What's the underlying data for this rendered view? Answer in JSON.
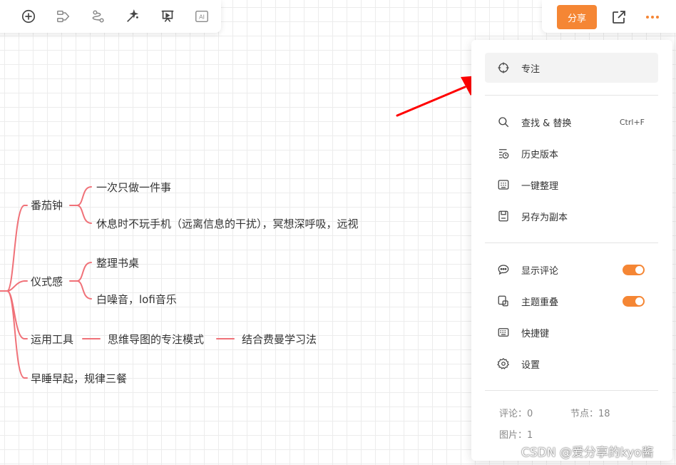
{
  "toolbar": {
    "tools": [
      {
        "icon": "add-circle-icon"
      },
      {
        "icon": "branch-icon"
      },
      {
        "icon": "relation-icon"
      },
      {
        "icon": "magic-icon"
      },
      {
        "icon": "presentation-icon"
      },
      {
        "icon": "ai-icon",
        "label": "AI"
      }
    ]
  },
  "header": {
    "share_label": "分享",
    "export_icon": "export-icon",
    "more_icon": "more-icon"
  },
  "menu": {
    "focus": {
      "label": "专注",
      "icon": "focus-icon"
    },
    "find": {
      "label": "查找 & 替换",
      "shortcut": "Ctrl+F",
      "icon": "search-icon"
    },
    "history": {
      "label": "历史版本",
      "icon": "history-icon"
    },
    "tidy": {
      "label": "一键整理",
      "icon": "tidy-icon"
    },
    "save_copy": {
      "label": "另存为副本",
      "icon": "save-icon"
    },
    "show_comments": {
      "label": "显示评论",
      "icon": "comment-icon",
      "enabled": true
    },
    "topic_overlap": {
      "label": "主题重叠",
      "icon": "overlap-icon",
      "enabled": true
    },
    "shortcuts": {
      "label": "快捷键",
      "icon": "keyboard-icon"
    },
    "settings": {
      "label": "设置",
      "icon": "gear-icon"
    }
  },
  "stats": {
    "comments": "评论：0",
    "nodes": "节点：18",
    "images": "图片：1"
  },
  "mindmap": {
    "branch1": {
      "label": "番茄钟",
      "children": [
        "一次只做一件事",
        "休息时不玩手机（远离信息的干扰），冥想深呼吸，远视"
      ]
    },
    "branch2": {
      "label": "仪式感",
      "children": [
        "整理书桌",
        "白噪音，lofi音乐"
      ]
    },
    "branch3": {
      "label": "运用工具",
      "child": "思维导图的专注模式",
      "grandchild": "结合费曼学习法"
    },
    "branch4": {
      "label": "早睡早起，规律三餐"
    },
    "line_color": "#f07178"
  },
  "annotation": {
    "arrow_color": "#ff0000"
  },
  "watermark": "CSDN @爱分享的kyo酱"
}
